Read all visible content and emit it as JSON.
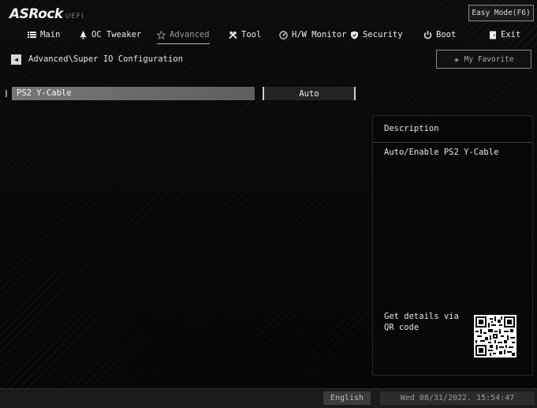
{
  "brand": {
    "name": "ASRock",
    "sub": "UEFI"
  },
  "header": {
    "easy_mode_label": "Easy Mode(F6)"
  },
  "tabs": [
    {
      "label": "Main",
      "icon": "list-icon"
    },
    {
      "label": "OC Tweaker",
      "icon": "rocket-icon"
    },
    {
      "label": "Advanced",
      "icon": "star-icon",
      "active": true
    },
    {
      "label": "Tool",
      "icon": "tools-icon"
    },
    {
      "label": "H/W Monitor",
      "icon": "gauge-icon"
    },
    {
      "label": "Security",
      "icon": "shield-icon"
    },
    {
      "label": "Boot",
      "icon": "power-icon"
    },
    {
      "label": "Exit",
      "icon": "door-icon"
    }
  ],
  "breadcrumb": {
    "path": "Advanced\\Super IO Configuration"
  },
  "favorite": {
    "label": "My Favorite"
  },
  "settings": [
    {
      "label": "PS2 Y-Cable",
      "value": "Auto"
    }
  ],
  "description": {
    "title": "Description",
    "text": "Auto/Enable PS2 Y-Cable",
    "qr_text": "Get details via QR code"
  },
  "footer": {
    "language": "English",
    "datetime": "Wed 08/31/2022. 15:54:47"
  },
  "colors": {
    "background": "#0a0a0a",
    "highlight_row": "#6b6b6b",
    "text": "#e6e6e6"
  }
}
